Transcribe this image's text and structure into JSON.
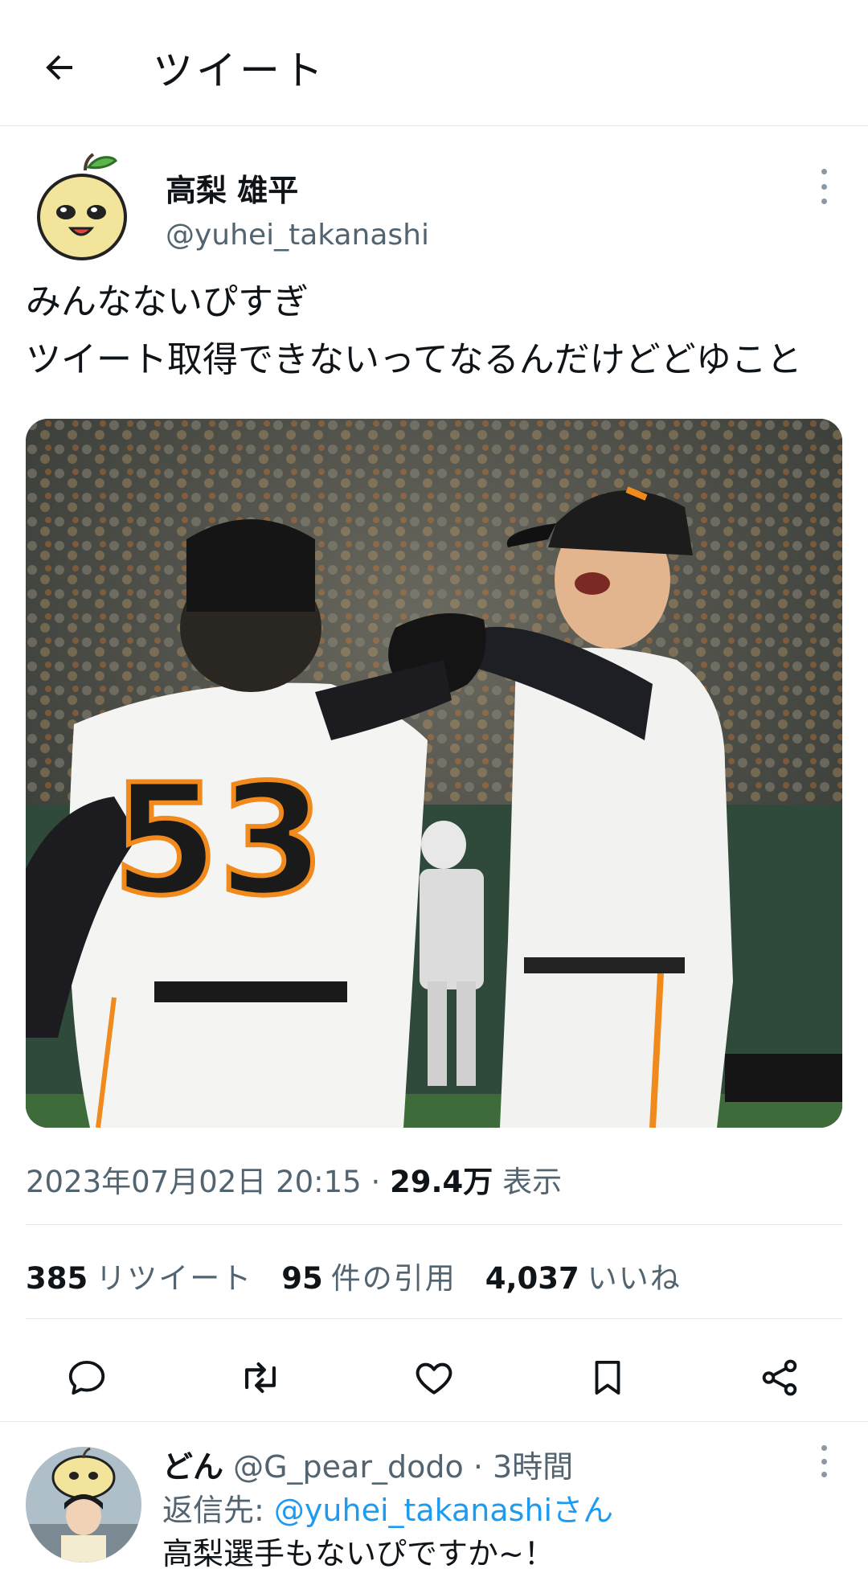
{
  "header": {
    "title": "ツイート"
  },
  "tweet": {
    "author_name": "高梨 雄平",
    "author_handle": "@yuhei_takanashi",
    "text_line1": "みんなないぴすぎ",
    "text_line2": "ツイート取得できないってなるんだけどどゆこと",
    "jersey_number": "53",
    "timestamp": "2023年07月02日 20:15",
    "separator": "·",
    "views_value": "29.4万",
    "views_label": "表示"
  },
  "stats": {
    "retweets_count": "385",
    "retweets_label": "リツイート",
    "quotes_count": "95",
    "quotes_label": "件の引用",
    "likes_count": "4,037",
    "likes_label": "いいね"
  },
  "reply": {
    "name": "どん",
    "handle": "@G_pear_dodo",
    "separator": "·",
    "time": "3時間",
    "reply_to_label": "返信先:",
    "reply_to_handle": "@yuhei_takanashiさん",
    "text": "高梨選手もないぴですか~！"
  },
  "colors": {
    "accent": "#1d9bf0",
    "muted": "#536471",
    "divider": "#e6e9eb",
    "jersey_orange": "#f08a1c"
  },
  "icons": [
    "back-arrow-icon",
    "more-vertical-icon",
    "reply-icon",
    "retweet-icon",
    "like-icon",
    "bookmark-icon",
    "share-icon"
  ]
}
